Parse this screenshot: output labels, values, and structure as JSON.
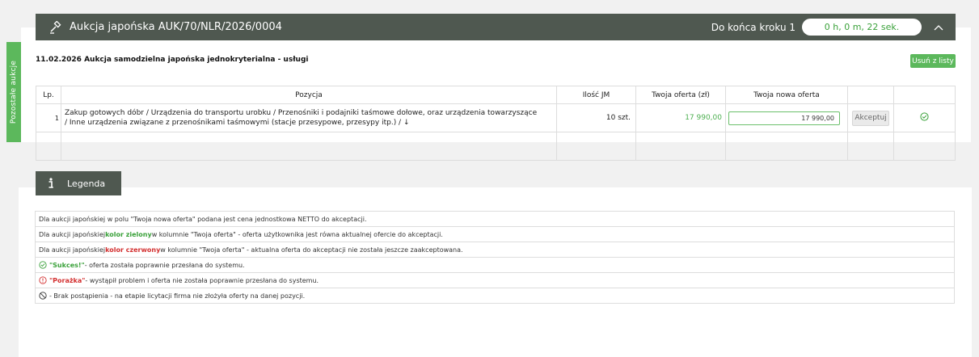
{
  "side_tab": {
    "label": "Pozostałe aukcje"
  },
  "auction": {
    "title": "Aukcja japońska AUK/70/NLR/2026/0004",
    "countdown_label": "Do końca kroku 1",
    "timer": "0 h, 0 m, 22 sek.",
    "subtitle": "11.02.2026 Aukcja samodzielna japońska jednokryterialna - usługi",
    "remove_label": "Usuń z listy",
    "columns": {
      "lp": "Lp.",
      "pozycja": "Pozycja",
      "ilosc": "Ilość JM",
      "oferta": "Twoja oferta (zł)",
      "nowa": "Twoja nowa oferta"
    },
    "rows": [
      {
        "lp": "1",
        "pozycja_line1": "Zakup gotowych dóbr / Urządzenia do transportu urobku / Przenośniki i podajniki taśmowe dołowe, oraz urządzenia towarzyszące",
        "pozycja_line2": "/ Inne urządzenia związane z przenośnikami taśmowymi (stacje przesypowe, przesypy itp.) / ↓",
        "ilosc": "10 szt.",
        "oferta": "17 990,00",
        "nowa": "17 990,00",
        "accept_label": "Akceptuj"
      }
    ]
  },
  "legend": {
    "title": "Legenda",
    "items": [
      {
        "text": "Dla aukcji japońskiej w polu \"Twoja nowa oferta\" podana jest cena jednostkowa NETTO do akceptacji."
      },
      {
        "pre": "Dla aukcji japońskiej ",
        "hl": "kolor zielony",
        "post": " w kolumnie \"Twoja oferta\" - oferta użytkownika jest równa aktualnej ofercie do akceptacji."
      },
      {
        "pre": "Dla aukcji japońskiej ",
        "hl": "kolor czerwony",
        "post": " w kolumnie \"Twoja oferta\" - aktualna oferta do akceptacji nie została jeszcze zaakceptowana."
      },
      {
        "hl": "\"Sukces!\"",
        "post": " - oferta została poprawnie przesłana do systemu."
      },
      {
        "hl": "\"Porażka\"",
        "post": " - wystąpił problem i oferta nie została poprawnie przesłana do systemu."
      },
      {
        "post": " - Brak postąpienia - na etapie licytacji firma nie złożyła oferty na danej pozycji."
      }
    ]
  },
  "colors": {
    "green": "#5cb85c",
    "header": "#4f5850",
    "red": "#d32f2f"
  }
}
